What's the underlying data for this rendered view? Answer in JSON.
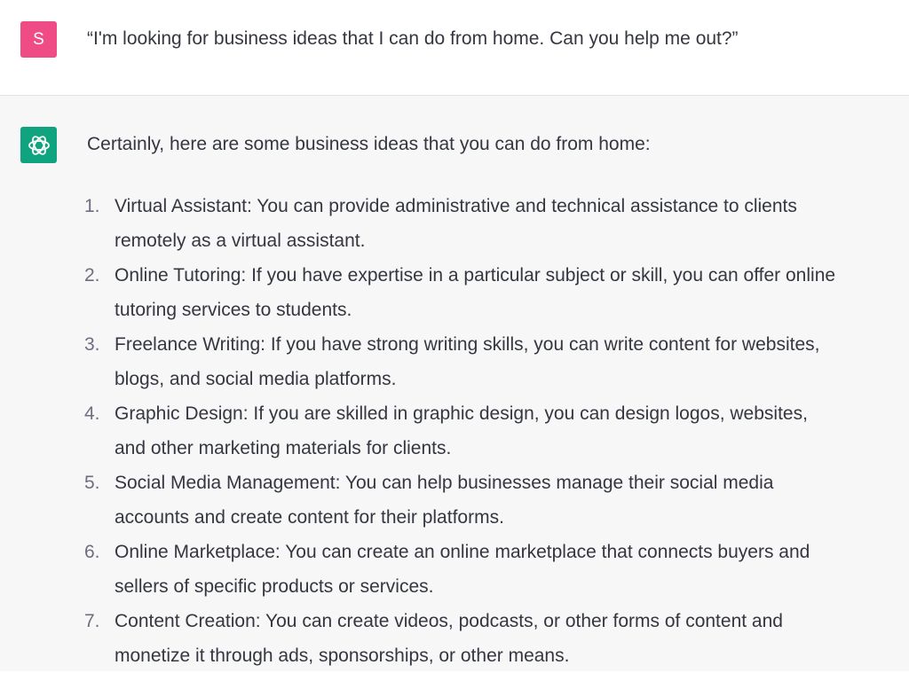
{
  "colors": {
    "user_avatar_bg": "#ef4b84",
    "bot_avatar_bg": "#10a37f",
    "bot_row_bg": "#f7f7f8"
  },
  "user": {
    "avatar_letter": "S",
    "message": "“I'm looking for business ideas that I can do from home. Can you help me out?”"
  },
  "assistant": {
    "avatar_icon": "openai-logo-icon",
    "intro": "Certainly, here are some business ideas that you can do from home:",
    "items": [
      {
        "num": "1.",
        "line1": "Virtual Assistant: You can provide administrative and technical assistance to clients",
        "line2": "remotely as a virtual assistant."
      },
      {
        "num": "2.",
        "line1": "Online Tutoring: If you have expertise in a particular subject or skill, you can offer online",
        "line2": "tutoring services to students."
      },
      {
        "num": "3.",
        "line1": "Freelance Writing: If you have strong writing skills, you can write content for websites,",
        "line2": "blogs, and social media platforms."
      },
      {
        "num": "4.",
        "line1": "Graphic Design: If you are skilled in graphic design, you can design logos, websites,",
        "line2": "and other marketing materials for clients."
      },
      {
        "num": "5.",
        "line1": "Social Media Management: You can help businesses manage their social media",
        "line2": "accounts and create content for their platforms."
      },
      {
        "num": "6.",
        "line1": "Online Marketplace: You can create an online marketplace that connects buyers and",
        "line2": "sellers of specific products or services."
      },
      {
        "num": "7.",
        "line1": "Content Creation: You can create videos, podcasts, or other forms of content and",
        "line2": "monetize it through ads, sponsorships, or other means."
      }
    ]
  }
}
